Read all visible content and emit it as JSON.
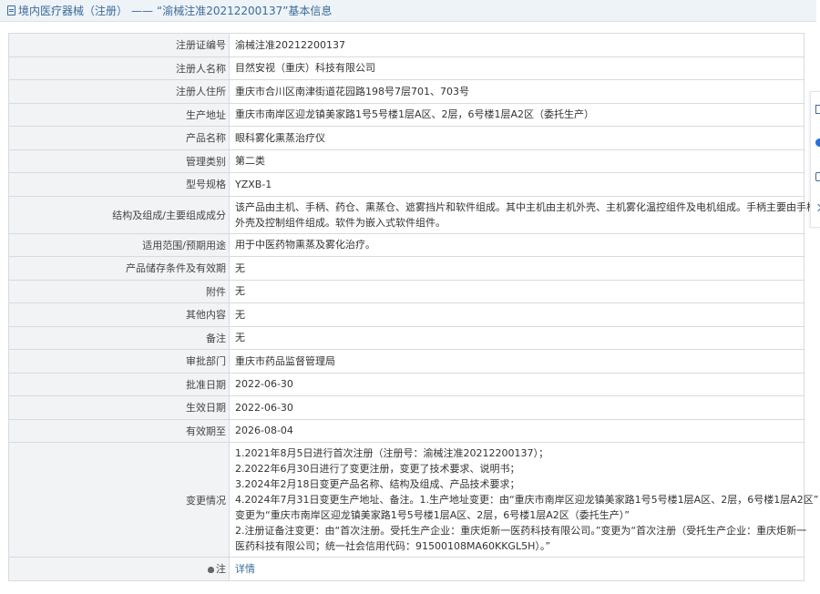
{
  "breadcrumb": {
    "section": "境内医疗器械（注册）",
    "separator": "——",
    "page": "“渝械注准20212200137”基本信息"
  },
  "rows": [
    {
      "label": "注册证编号",
      "value": "渝械注准20212200137"
    },
    {
      "label": "注册人名称",
      "value": "目然安视（重庆）科技有限公司"
    },
    {
      "label": "注册人住所",
      "value": "重庆市合川区南津街道花园路198号7层701、703号"
    },
    {
      "label": "生产地址",
      "value": "重庆市南岸区迎龙镇美家路1号5号楼1层A区、2层，6号楼1层A2区（委托生产）"
    },
    {
      "label": "产品名称",
      "value": "眼科雾化熏蒸治疗仪"
    },
    {
      "label": "管理类别",
      "value": "第二类"
    },
    {
      "label": "型号规格",
      "value": "YZXB-1"
    },
    {
      "label": "结构及组成/主要组成成分",
      "lines": [
        "该产品由主机、手柄、药仓、熏蒸仓、遮雾挡片和软件组成。其中主机由主机外壳、主机雾化温控组件及电机组成。手柄主要由手柄",
        "外壳及控制组件组成。软件为嵌入式软件组件。"
      ]
    },
    {
      "label": "适用范围/预期用途",
      "value": "用于中医药物熏蒸及雾化治疗。"
    },
    {
      "label": "产品储存条件及有效期",
      "value": "无"
    },
    {
      "label": "附件",
      "value": "无"
    },
    {
      "label": "其他内容",
      "value": "无"
    },
    {
      "label": "备注",
      "value": "无"
    },
    {
      "label": "审批部门",
      "value": "重庆市药品监督管理局"
    },
    {
      "label": "批准日期",
      "value": "2022-06-30"
    },
    {
      "label": "生效日期",
      "value": "2022-06-30"
    },
    {
      "label": "有效期至",
      "value": "2026-08-04"
    },
    {
      "label": "变更情况",
      "lines": [
        "1.2021年8月5日进行首次注册（注册号：渝械注准20212200137）；",
        "2.2022年6月30日进行了变更注册，变更了技术要求、说明书；",
        "3.2024年2月18日变更产品名称、结构及组成、产品技术要求；",
        "4.2024年7月31日变更生产地址、备注。1.生产地址变更：由“重庆市南岸区迎龙镇美家路1号5号楼1层A区、2层，6号楼1层A2区”",
        "变更为“重庆市南岸区迎龙镇美家路1号5号楼1层A区、2层，6号楼1层A2区（委托生产）”",
        "2.注册证备注变更：由“首次注册。受托生产企业：重庆炬新一医药科技有限公司。”变更为“首次注册（受托生产企业：重庆炬新一",
        "医药科技有限公司；统一社会信用代码：91500108MA60KKGL5H）。”"
      ]
    },
    {
      "label": "注",
      "value": "详情",
      "link": true
    }
  ],
  "icons": {
    "breadcrumb": "document-icon",
    "note": "bell-icon",
    "toolbar": [
      "document-icon",
      "circle-icon",
      "copy-icon",
      "chevron-icon"
    ]
  },
  "colors": {
    "link": "#3b6b99",
    "label_bg": "#f1f3f5",
    "border": "#d6dbe1"
  }
}
